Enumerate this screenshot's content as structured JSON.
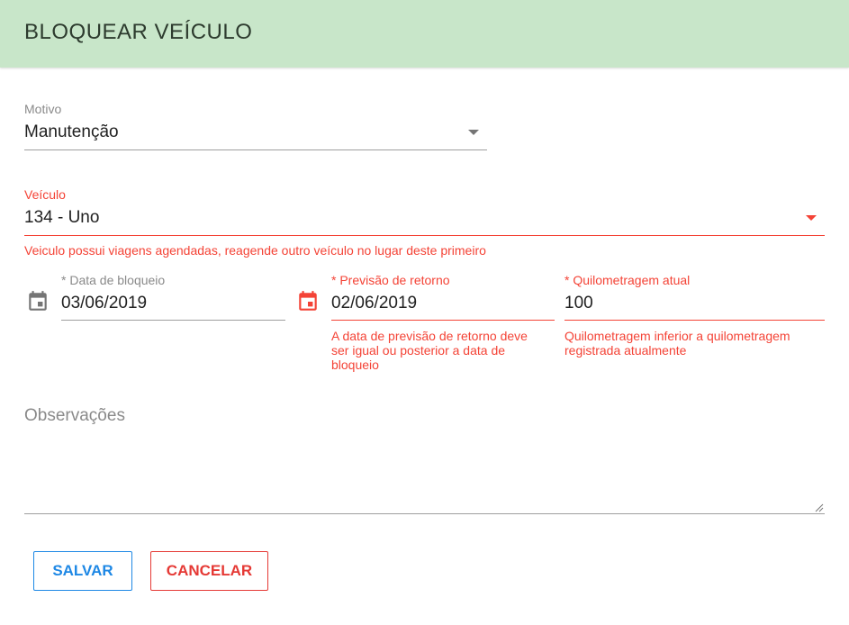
{
  "header": {
    "title": "BLOQUEAR VEÍCULO"
  },
  "motivo": {
    "label": "Motivo",
    "value": "Manutenção"
  },
  "veiculo": {
    "label": "Veículo",
    "value": "134 - Uno",
    "error": "Veiculo possui viagens agendadas, reagende outro veículo no lugar deste primeiro"
  },
  "data_bloqueio": {
    "label": "* Data de bloqueio",
    "value": "03/06/2019"
  },
  "previsao_retorno": {
    "label": "* Previsão de retorno",
    "value": "02/06/2019",
    "error_lines": [
      "A data de previsão de retorno deve",
      "ser igual ou posterior a data de",
      "bloqueio"
    ]
  },
  "quilometragem": {
    "label": "* Quilometragem atual",
    "value": "100",
    "error_lines": [
      "Quilometragem inferior a quilometragem",
      "registrada atualmente"
    ]
  },
  "observacoes": {
    "placeholder": "Observações"
  },
  "actions": {
    "save_label": "SALVAR",
    "cancel_label": "CANCELAR"
  },
  "colors": {
    "header_bg": "#c8e6c9",
    "error": "#f44336",
    "primary": "#1e88e5"
  }
}
